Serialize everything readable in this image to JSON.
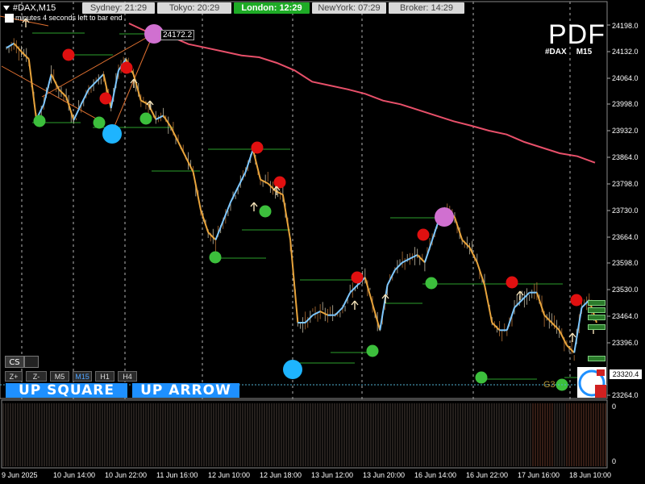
{
  "window": {
    "symbol_title": "#DAX,M15"
  },
  "countdown_text": "minutes 4 seconds left to bar end",
  "sessions": [
    {
      "name": "sydney",
      "label": "Sydney: 21:29",
      "active": false
    },
    {
      "name": "tokyo",
      "label": "Tokyo: 20:29",
      "active": false
    },
    {
      "name": "london",
      "label": "London: 12:29",
      "active": true
    },
    {
      "name": "newyork",
      "label": "NewYork: 07:29",
      "active": false
    },
    {
      "name": "broker",
      "label": "Broker: 14:29",
      "active": false
    }
  ],
  "logo": {
    "text": "PDF",
    "symbol": "#DAX",
    "timeframe": "M15"
  },
  "level_tag": "24172.2",
  "current_price": "23320.4",
  "right_edge_label": "G3",
  "controls": {
    "cs_label": "CS",
    "zoom_in": "Z+",
    "zoom_out": "Z-",
    "timeframes": [
      {
        "label": "M5",
        "active": false
      },
      {
        "label": "M15",
        "active": true
      },
      {
        "label": "H1",
        "active": false
      },
      {
        "label": "H4",
        "active": false
      }
    ],
    "up_square_label": "UP SQUARE",
    "up_arrow_label": "UP ARROW"
  },
  "price_axis": [
    "24198.0",
    "24132.0",
    "24064.0",
    "23998.0",
    "23932.0",
    "23864.0",
    "23798.0",
    "23730.0",
    "23664.0",
    "23598.0",
    "23530.0",
    "23464.0",
    "23396.0",
    "23264.0"
  ],
  "sub_axis": [
    "0",
    "0"
  ],
  "time_axis": [
    "9 Jun 2025",
    "10 Jun 14:00",
    "10 Jun 22:00",
    "11 Jun 16:00",
    "12 Jun 10:00",
    "12 Jun 18:00",
    "13 Jun 12:00",
    "13 Jun 20:00",
    "16 Jun 14:00",
    "16 Jun 22:00",
    "17 Jun 16:00",
    "18 Jun 10:00"
  ],
  "colors": {
    "bull": "#7ec8ff",
    "bear": "#e8a43c",
    "signal_up": "#3cbf3c",
    "signal_down": "#e01010",
    "ma": "#e8506a",
    "big_circle_blue": "#1eb4ff",
    "big_circle_pink": "#d070d0",
    "session_active": "#1eab26",
    "button_blue": "#1e90ff"
  },
  "chart_data": {
    "type": "line",
    "symbol": "#DAX",
    "timeframe": "M15",
    "ylim": [
      23240,
      24230
    ],
    "series": [
      {
        "values": [
          24150,
          24162,
          24140,
          24120,
          23960,
          24000,
          24080,
          24040,
          24020,
          23958,
          24000,
          24040,
          24060,
          24080,
          23990,
          24090,
          24120,
          24080,
          24010,
          24000,
          23960,
          23970,
          23940,
          23900,
          23860,
          23820,
          23720,
          23660,
          23640,
          23690,
          23740,
          23780,
          23820,
          23880,
          23800,
          23790,
          23770,
          23760,
          23640,
          23420,
          23420,
          23440,
          23450,
          23440,
          23440,
          23460,
          23500,
          23520,
          23540,
          23470,
          23400,
          23520,
          23560,
          23580,
          23590,
          23600,
          23580,
          23640,
          23700,
          23720,
          23700,
          23640,
          23620,
          23580,
          23520,
          23420,
          23400,
          23400,
          23460,
          23480,
          23500,
          23500,
          23440,
          23420,
          23400,
          23360,
          23340,
          23460,
          23480,
          23420
        ]
      },
      {
        "values": [
          24186,
          24180,
          24160,
          24150,
          24140,
          24130,
          24125,
          24110,
          24090,
          24060,
          24050,
          24040,
          24028,
          24010,
          24000,
          23985,
          23970,
          23955,
          23943,
          23930,
          23920,
          23900,
          23885,
          23870,
          23862,
          23845
        ]
      }
    ],
    "signals_up_price": [
      23950,
      23945,
      23960,
      23620,
      23740,
      23400,
      23565,
      23320,
      23300
    ],
    "signals_down_price": [
      24080,
      24040,
      23990,
      23880,
      23800,
      23570,
      23670,
      23555,
      23500
    ],
    "levels": [
      24172.2,
      23730,
      23420,
      23320.4
    ]
  }
}
